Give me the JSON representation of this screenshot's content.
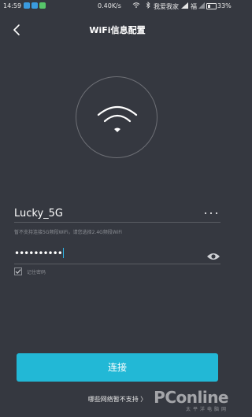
{
  "status_bar": {
    "time": "14:59",
    "speed": "0.40K/s",
    "carrier1": "我爱我家",
    "carrier2": "福",
    "battery": "33%"
  },
  "header": {
    "title": "WiFi信息配置",
    "back_icon": "chevron-left-icon"
  },
  "wifi_icon": "wifi-icon",
  "network": {
    "ssid": "Lucky_5G",
    "hint": "暂不支持连接5G频段WiFi，请您选择2.4G频段WiFi"
  },
  "password": {
    "masked_value": "••••••••••",
    "eye_icon": "eye-icon"
  },
  "remember": {
    "label": "记住密码",
    "checked": true
  },
  "actions": {
    "connect_label": "连接",
    "unsupported_label": "哪些网络暂不支持 〉"
  },
  "watermark": {
    "brand": "PConline",
    "sub": "太平洋电脑网"
  },
  "colors": {
    "background": "#353840",
    "accent": "#22b8d6"
  }
}
